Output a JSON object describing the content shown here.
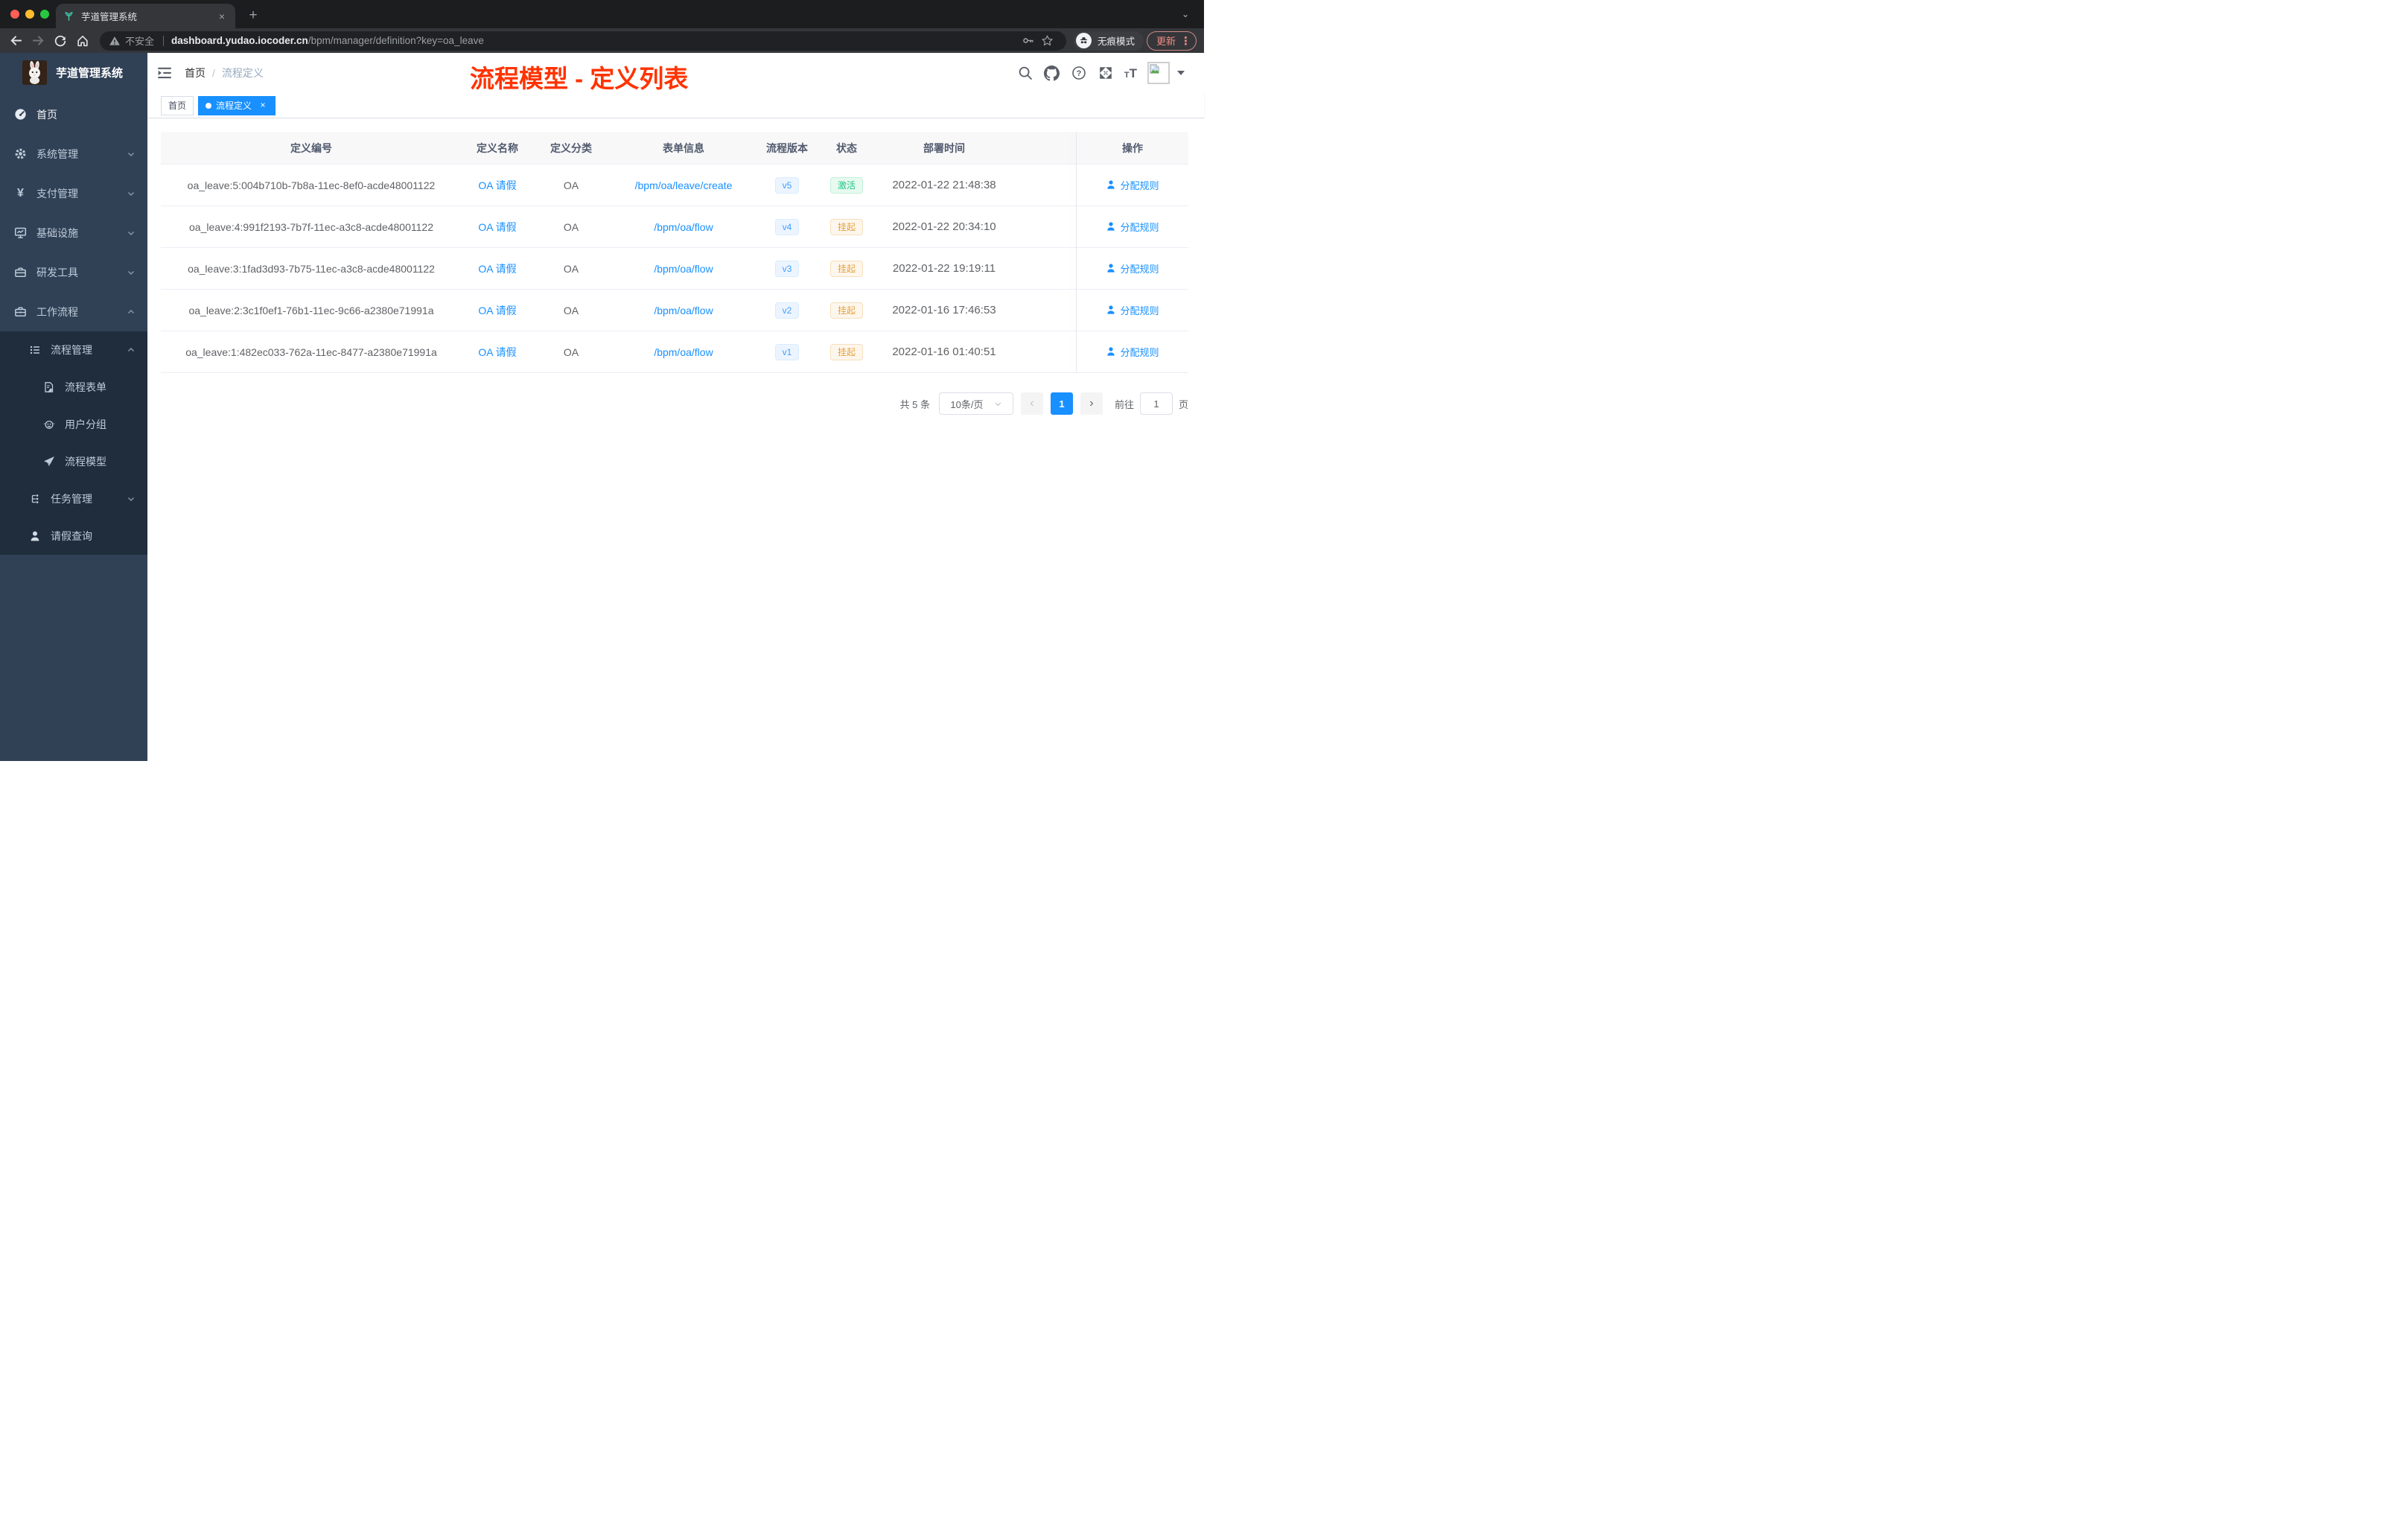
{
  "browser": {
    "tab_title": "芋道管理系统",
    "security_label": "不安全",
    "url_host": "dashboard.yudao.iocoder.cn",
    "url_path": "/bpm/manager/definition?key=oa_leave",
    "incognito_label": "无痕模式",
    "update_label": "更新"
  },
  "sidebar": {
    "app_title": "芋道管理系统",
    "menu": [
      {
        "label": "首页",
        "icon": "dashboard-icon"
      },
      {
        "label": "系统管理",
        "icon": "gear-icon",
        "state": "collapsed"
      },
      {
        "label": "支付管理",
        "icon": "yen-icon",
        "state": "collapsed"
      },
      {
        "label": "基础设施",
        "icon": "monitor-icon",
        "state": "collapsed"
      },
      {
        "label": "研发工具",
        "icon": "toolbox-icon",
        "state": "collapsed"
      },
      {
        "label": "工作流程",
        "icon": "briefcase-icon",
        "state": "expanded"
      }
    ],
    "workflow_children": [
      {
        "label": "流程管理",
        "icon": "list-icon",
        "state": "expanded",
        "children": [
          {
            "label": "流程表单",
            "icon": "form-icon"
          },
          {
            "label": "用户分组",
            "icon": "robot-icon"
          },
          {
            "label": "流程模型",
            "icon": "send-icon"
          }
        ]
      },
      {
        "label": "任务管理",
        "icon": "tree-icon",
        "state": "collapsed"
      },
      {
        "label": "请假查询",
        "icon": "user-icon"
      }
    ]
  },
  "header": {
    "breadcrumb": [
      "首页",
      "流程定义"
    ],
    "breadcrumb_separator": "/",
    "annotation": "流程模型 - 定义列表"
  },
  "tags_view": [
    {
      "label": "首页",
      "active": false
    },
    {
      "label": "流程定义",
      "active": true
    }
  ],
  "table": {
    "columns": [
      "定义编号",
      "定义名称",
      "定义分类",
      "表单信息",
      "流程版本",
      "状态",
      "部署时间",
      "操作"
    ],
    "rows": [
      {
        "id": "oa_leave:5:004b710b-7b8a-11ec-8ef0-acde48001122",
        "name": "OA 请假",
        "category": "OA",
        "form": "/bpm/oa/leave/create",
        "version": "v5",
        "status": "激活",
        "status_type": "success",
        "deploy_time": "2022-01-22 21:48:38",
        "action": "分配规则"
      },
      {
        "id": "oa_leave:4:991f2193-7b7f-11ec-a3c8-acde48001122",
        "name": "OA 请假",
        "category": "OA",
        "form": "/bpm/oa/flow",
        "version": "v4",
        "status": "挂起",
        "status_type": "warning",
        "deploy_time": "2022-01-22 20:34:10",
        "action": "分配规则"
      },
      {
        "id": "oa_leave:3:1fad3d93-7b75-11ec-a3c8-acde48001122",
        "name": "OA 请假",
        "category": "OA",
        "form": "/bpm/oa/flow",
        "version": "v3",
        "status": "挂起",
        "status_type": "warning",
        "deploy_time": "2022-01-22 19:19:11",
        "action": "分配规则"
      },
      {
        "id": "oa_leave:2:3c1f0ef1-76b1-11ec-9c66-a2380e71991a",
        "name": "OA 请假",
        "category": "OA",
        "form": "/bpm/oa/flow",
        "version": "v2",
        "status": "挂起",
        "status_type": "warning",
        "deploy_time": "2022-01-16 17:46:53",
        "action": "分配规则"
      },
      {
        "id": "oa_leave:1:482ec033-762a-11ec-8477-a2380e71991a",
        "name": "OA 请假",
        "category": "OA",
        "form": "/bpm/oa/flow",
        "version": "v1",
        "status": "挂起",
        "status_type": "warning",
        "deploy_time": "2022-01-16 01:40:51",
        "action": "分配规则"
      }
    ]
  },
  "pagination": {
    "total": "共 5 条",
    "page_size": "10条/页",
    "current_page": "1",
    "goto_label": "前往",
    "goto_value": "1",
    "goto_unit": "页"
  },
  "colors": {
    "primary": "#1890ff",
    "link": "#1890ff",
    "tag_version_text": "#409eff",
    "tag_version_bg": "#ecf5ff",
    "status_active_text": "#23c483",
    "status_active_bg": "#e7faf0",
    "status_suspended_text": "#e6a23c",
    "status_suspended_bg": "#fdf6ec",
    "sidebar_bg": "#304156",
    "submenu_bg": "#1f2d3d",
    "annotation_red": "#ff3300"
  }
}
